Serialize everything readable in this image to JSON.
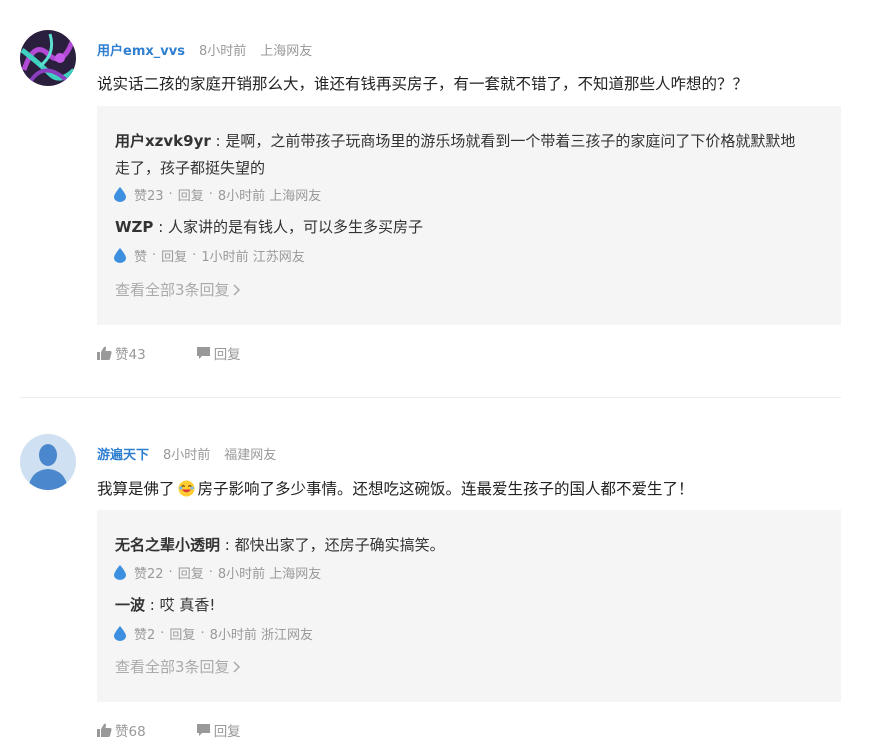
{
  "comments": [
    {
      "user": "用户emx_vvs",
      "time": "8小时前",
      "location": "上海网友",
      "text": "说实话二孩的家庭开销那么大，谁还有钱再买房子，有一套就不错了，不知道那些人咋想的？？",
      "replies": [
        {
          "user": "用户xzvk9yr",
          "text_line1": "是啊，之前带孩子玩商场里的游乐场就看到一个带着三孩子的家庭问了下价格就默默地",
          "text_line2": "走了，孩子都挺失望的",
          "likes": "赞23",
          "reply_label": "回复",
          "meta": "8小时前 上海网友"
        },
        {
          "user": "WZP",
          "text_line1": "人家讲的是有钱人，可以多生多买房子",
          "likes": "赞",
          "reply_label": "回复",
          "meta": "1小时前 江苏网友"
        }
      ],
      "view_all": "查看全部3条回复",
      "like_count": "赞43",
      "reply_button": "回复"
    },
    {
      "user": "游遍天下",
      "time": "8小时前",
      "location": "福建网友",
      "text_before_emoji": "我算是佛了",
      "text_after_emoji": "房子影响了多少事情。还想吃这碗饭。连最爱生孩子的国人都不爱生了！",
      "replies": [
        {
          "user": "无名之辈小透明",
          "text_line1": "都快出家了，还房子确实搞笑。",
          "likes": "赞22",
          "reply_label": "回复",
          "meta": "8小时前 上海网友"
        },
        {
          "user": "一波",
          "text_line1": "哎 真香!",
          "likes": "赞2",
          "reply_label": "回复",
          "meta": "8小时前 浙江网友"
        }
      ],
      "view_all": "查看全部3条回复",
      "like_count": "赞68",
      "reply_button": "回复"
    }
  ],
  "colors": {
    "username_blue": "#2f7fd1",
    "drop_blue": "#3d8fe0",
    "reply_bg": "#f5f5f5",
    "meta_gray": "#999999"
  }
}
